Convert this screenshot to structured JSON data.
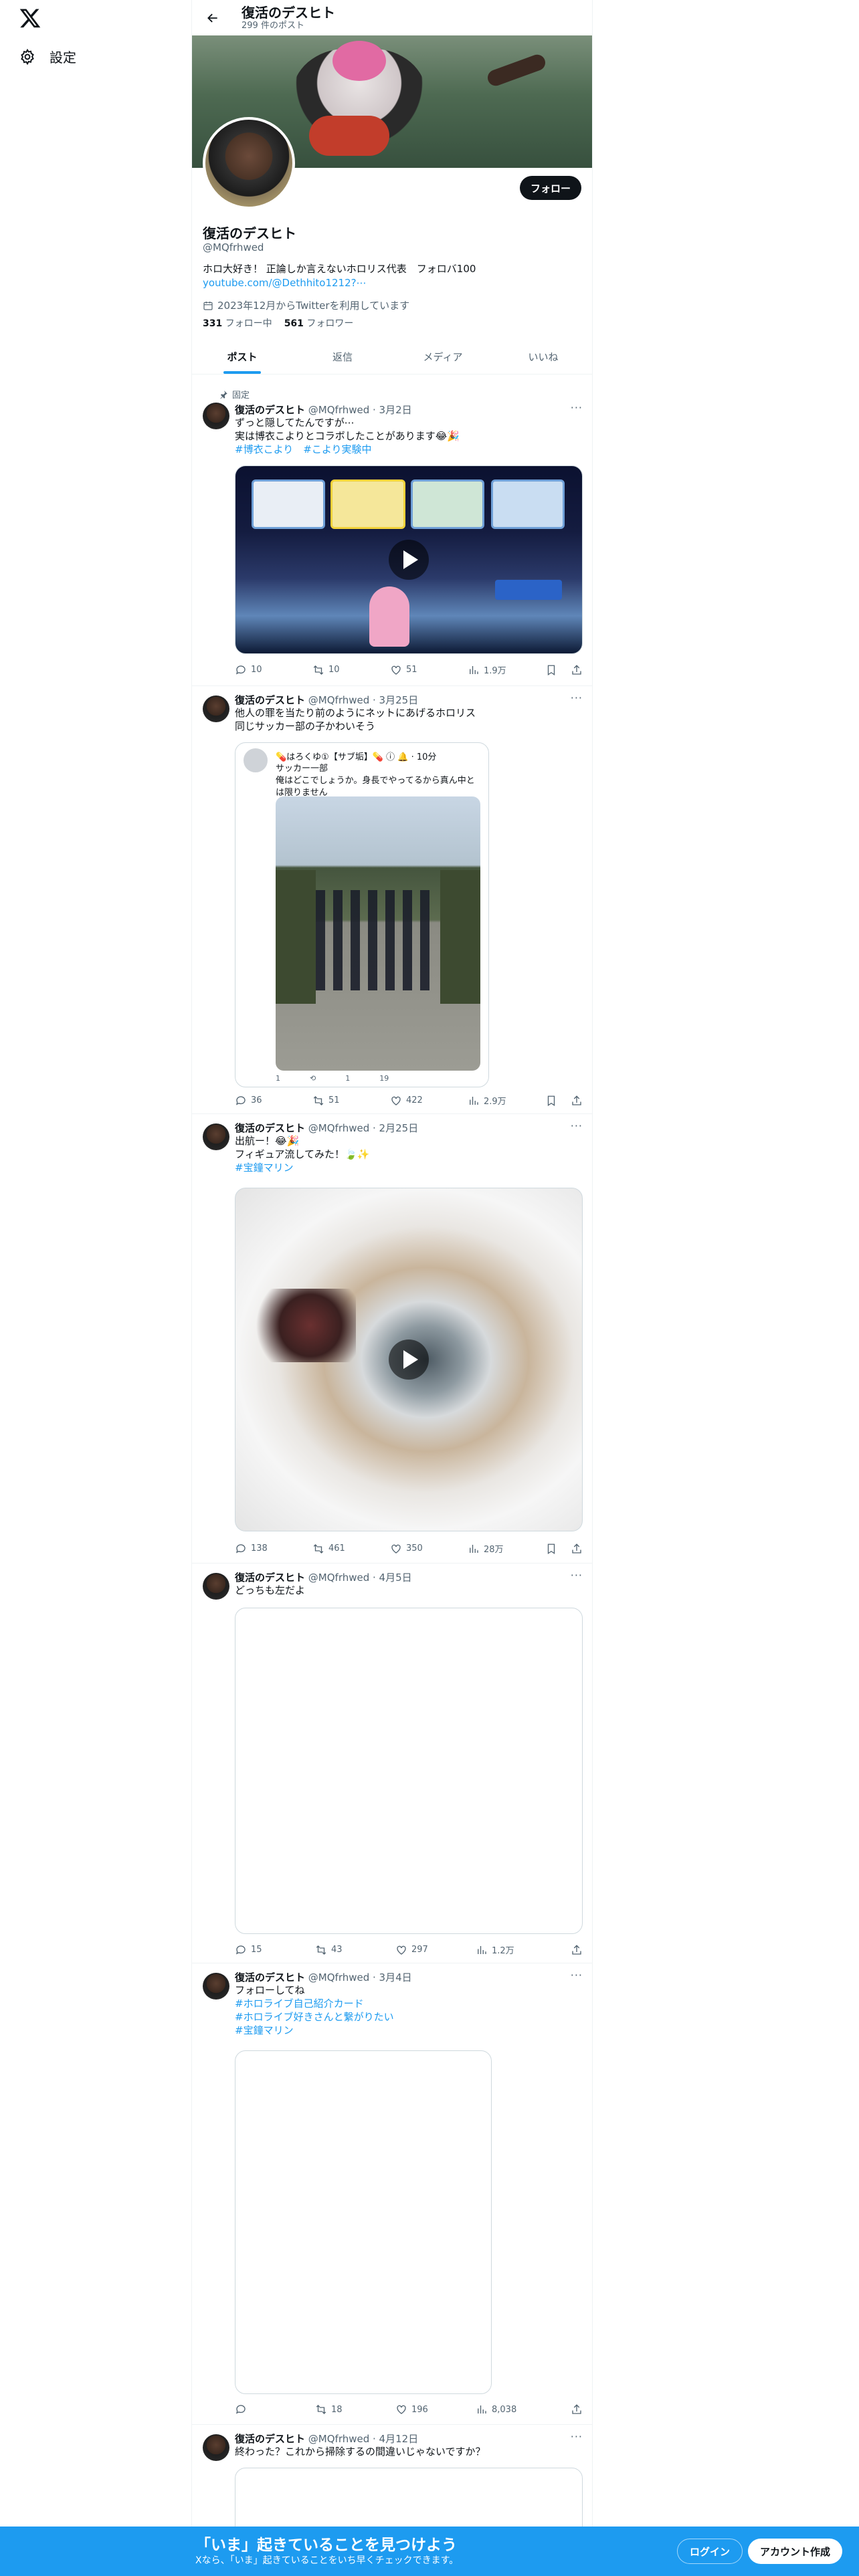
{
  "nav": {
    "settings": "設定"
  },
  "topbar": {
    "title": "復活のデスヒト",
    "post_count": "299 件のポスト"
  },
  "profile": {
    "name": "復活のデスヒト",
    "handle": "@MQfrhwed",
    "bio": "ホロ大好き！ 正論しか言えないホロリス代表　フォロバ100",
    "link": "youtube.com/@Dethhito1212?⋯",
    "joined": "2023年12月からTwitterを利用しています",
    "following_count": "331",
    "following_label": "フォロー中",
    "followers_count": "561",
    "followers_label": "フォロワー",
    "follow_button": "フォロー"
  },
  "tabs": [
    "ポスト",
    "返信",
    "メディア",
    "いいね"
  ],
  "tweets": [
    {
      "pinned_label": "固定",
      "name": "復活のデスヒト",
      "meta": "@MQfrhwed · 3月2日",
      "line1": "ずっと隠してたんですが⋯",
      "line2": "実は博衣こよりとコラボしたことがあります😂🎉",
      "line3": "#博衣こより　#こより実験中",
      "replies": "10",
      "reposts": "10",
      "likes": "51",
      "views": "1.9万"
    },
    {
      "name": "復活のデスヒト",
      "meta": "@MQfrhwed · 3月25日",
      "line1": "他人の罪を当たり前のようにネットにあげるホロリス",
      "line2": "同じサッカー部の子かわいそう",
      "quote_head": "💊はろくゆ①【サブ垢】💊 ⓘ 🔔 · 10分",
      "quote_line1": "サッカー一部",
      "quote_line2": "俺はどこでしょうか。身長でやってるから真ん中と",
      "quote_line3": "は限りません",
      "quote_replies": "1",
      "quote_likes": "1",
      "quote_views": "19",
      "replies": "36",
      "reposts": "51",
      "likes": "422",
      "views": "2.9万"
    },
    {
      "name": "復活のデスヒト",
      "meta": "@MQfrhwed · 2月25日",
      "line1": "出航ー！😂🎉",
      "line2": "フィギュア流してみた！🍃✨",
      "line3": "#宝鐘マリン",
      "replies": "138",
      "reposts": "461",
      "likes": "350",
      "views": "28万"
    },
    {
      "name": "復活のデスヒト",
      "meta": "@MQfrhwed · 4月5日",
      "line1": "どっちも左だよ",
      "replies": "15",
      "reposts": "43",
      "likes": "297",
      "views": "1.2万"
    },
    {
      "name": "復活のデスヒト",
      "meta": "@MQfrhwed · 3月4日",
      "line1": "フォローしてね",
      "line2": "#ホロライブ自己紹介カード",
      "line3": "#ホロライブ好きさんと繋がりたい",
      "line4": "#宝鐘マリン",
      "replies": "",
      "reposts": "18",
      "likes": "196",
      "views": "8,038"
    },
    {
      "name": "復活のデスヒト",
      "meta": "@MQfrhwed · 4月12日",
      "line1": "終わった？これから掃除するの間違いじゃないですか？"
    }
  ],
  "bottom": {
    "title": "「いま」起きていることを見つけよう",
    "subtitle": "Xなら、「いま」起きていることをいち早くチェックできます。",
    "login": "ログイン",
    "signup": "アカウント作成"
  },
  "colors": {
    "accent": "#1d9bf0",
    "text": "#0f1419",
    "muted": "#536471"
  }
}
